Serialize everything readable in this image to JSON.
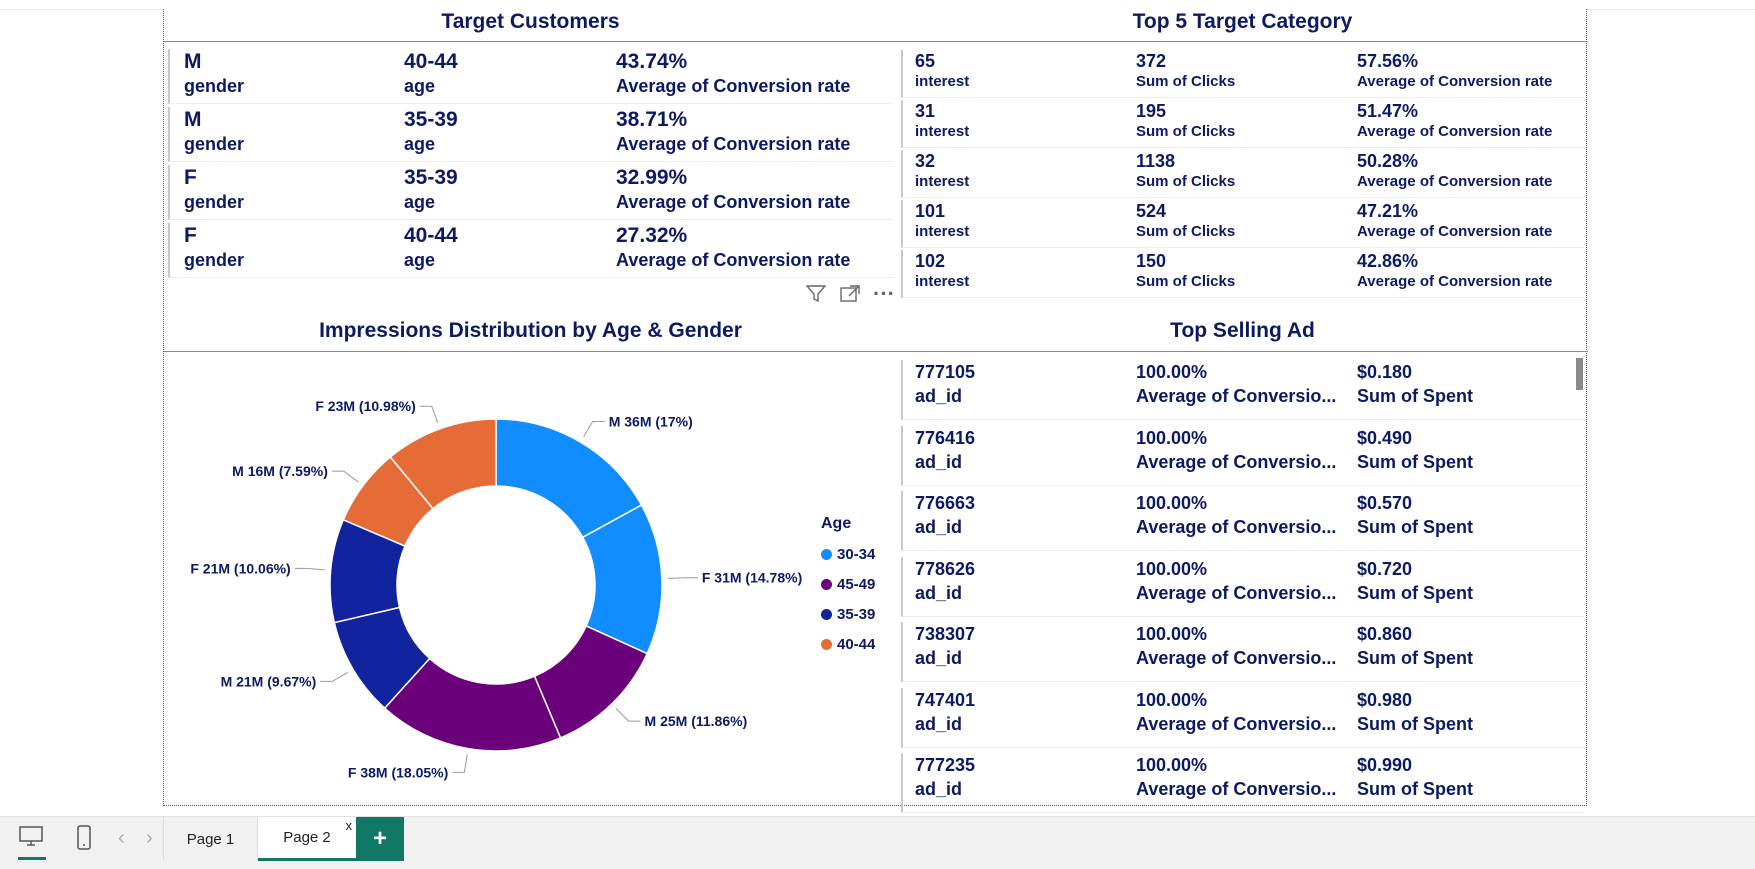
{
  "target_customers": {
    "title": "Target Customers",
    "rows": [
      {
        "gender": "M",
        "gender_label": "gender",
        "age": "40-44",
        "age_label": "age",
        "rate": "43.74%",
        "rate_label": "Average of Conversion rate"
      },
      {
        "gender": "M",
        "gender_label": "gender",
        "age": "35-39",
        "age_label": "age",
        "rate": "38.71%",
        "rate_label": "Average of Conversion rate"
      },
      {
        "gender": "F",
        "gender_label": "gender",
        "age": "35-39",
        "age_label": "age",
        "rate": "32.99%",
        "rate_label": "Average of Conversion rate"
      },
      {
        "gender": "F",
        "gender_label": "gender",
        "age": "40-44",
        "age_label": "age",
        "rate": "27.32%",
        "rate_label": "Average of Conversion rate"
      }
    ]
  },
  "top_categories": {
    "title": "Top 5 Target Category",
    "rows": [
      {
        "interest": "65",
        "interest_label": "interest",
        "clicks": "372",
        "clicks_label": "Sum of Clicks",
        "rate": "57.56%",
        "rate_label": "Average of Conversion rate"
      },
      {
        "interest": "31",
        "interest_label": "interest",
        "clicks": "195",
        "clicks_label": "Sum of Clicks",
        "rate": "51.47%",
        "rate_label": "Average of Conversion rate"
      },
      {
        "interest": "32",
        "interest_label": "interest",
        "clicks": "1138",
        "clicks_label": "Sum of Clicks",
        "rate": "50.28%",
        "rate_label": "Average of Conversion rate"
      },
      {
        "interest": "101",
        "interest_label": "interest",
        "clicks": "524",
        "clicks_label": "Sum of Clicks",
        "rate": "47.21%",
        "rate_label": "Average of Conversion rate"
      },
      {
        "interest": "102",
        "interest_label": "interest",
        "clicks": "150",
        "clicks_label": "Sum of Clicks",
        "rate": "42.86%",
        "rate_label": "Average of Conversion rate"
      }
    ]
  },
  "visual_header": {
    "filter_icon": "filter-icon",
    "focus_icon": "focus-mode-icon",
    "more_icon": "more-options-icon",
    "more_glyph": "···"
  },
  "impressions_chart": {
    "title": "Impressions Distribution by Age & Gender"
  },
  "chart_data": {
    "type": "pie",
    "title": "Impressions Distribution by Age & Gender",
    "donut": true,
    "legend_title": "Age",
    "legend_position": "right",
    "legend": [
      {
        "name": "30-34",
        "color": "#118dff"
      },
      {
        "name": "45-49",
        "color": "#6b007b"
      },
      {
        "name": "35-39",
        "color": "#12239e"
      },
      {
        "name": "40-44",
        "color": "#e66c37"
      }
    ],
    "slices": [
      {
        "label": "M 36M (17%)",
        "age": "30-34",
        "gender": "M",
        "value_millions": 36,
        "percent": 17.0,
        "color": "#118dff"
      },
      {
        "label": "F 31M (14.78%)",
        "age": "30-34",
        "gender": "F",
        "value_millions": 31,
        "percent": 14.78,
        "color": "#118dff"
      },
      {
        "label": "M 25M (11.86%)",
        "age": "45-49",
        "gender": "M",
        "value_millions": 25,
        "percent": 11.86,
        "color": "#6b007b"
      },
      {
        "label": "F 38M (18.05%)",
        "age": "45-49",
        "gender": "F",
        "value_millions": 38,
        "percent": 18.05,
        "color": "#6b007b"
      },
      {
        "label": "M 21M (9.67%)",
        "age": "35-39",
        "gender": "M",
        "value_millions": 21,
        "percent": 9.67,
        "color": "#12239e"
      },
      {
        "label": "F 21M (10.06%)",
        "age": "35-39",
        "gender": "F",
        "value_millions": 21,
        "percent": 10.06,
        "color": "#12239e"
      },
      {
        "label": "M 16M (7.59%)",
        "age": "40-44",
        "gender": "M",
        "value_millions": 16,
        "percent": 7.59,
        "color": "#e66c37"
      },
      {
        "label": "F 23M (10.98%)",
        "age": "40-44",
        "gender": "F",
        "value_millions": 23,
        "percent": 10.98,
        "color": "#e66c37"
      }
    ]
  },
  "top_ads": {
    "title": "Top Selling Ad",
    "rows": [
      {
        "ad_id": "777105",
        "ad_id_label": "ad_id",
        "rate": "100.00%",
        "rate_label": "Average of Conversio...",
        "spent": "$0.180",
        "spent_label": "Sum of Spent"
      },
      {
        "ad_id": "776416",
        "ad_id_label": "ad_id",
        "rate": "100.00%",
        "rate_label": "Average of Conversio...",
        "spent": "$0.490",
        "spent_label": "Sum of Spent"
      },
      {
        "ad_id": "776663",
        "ad_id_label": "ad_id",
        "rate": "100.00%",
        "rate_label": "Average of Conversio...",
        "spent": "$0.570",
        "spent_label": "Sum of Spent"
      },
      {
        "ad_id": "778626",
        "ad_id_label": "ad_id",
        "rate": "100.00%",
        "rate_label": "Average of Conversio...",
        "spent": "$0.720",
        "spent_label": "Sum of Spent"
      },
      {
        "ad_id": "738307",
        "ad_id_label": "ad_id",
        "rate": "100.00%",
        "rate_label": "Average of Conversio...",
        "spent": "$0.860",
        "spent_label": "Sum of Spent"
      },
      {
        "ad_id": "747401",
        "ad_id_label": "ad_id",
        "rate": "100.00%",
        "rate_label": "Average of Conversio...",
        "spent": "$0.980",
        "spent_label": "Sum of Spent"
      },
      {
        "ad_id": "777235",
        "ad_id_label": "ad_id",
        "rate": "100.00%",
        "rate_label": "Average of Conversio...",
        "spent": "$0.990",
        "spent_label": "Sum of Spent"
      }
    ]
  },
  "bottom_bar": {
    "desktop_icon": "desktop-view-icon",
    "mobile_icon": "mobile-view-icon",
    "prev_glyph": "‹",
    "next_glyph": "›",
    "pages": [
      {
        "label": "Page 1",
        "active": false
      },
      {
        "label": "Page 2",
        "active": true
      }
    ],
    "close_glyph": "x",
    "add_glyph": "+",
    "accent_color": "#117865"
  }
}
